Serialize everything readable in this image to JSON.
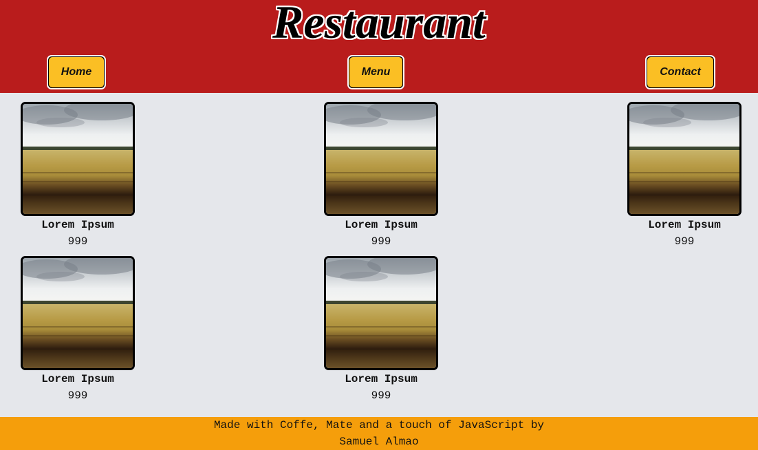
{
  "header": {
    "title": "Restaurant",
    "nav": [
      {
        "label": "Home"
      },
      {
        "label": "Menu"
      },
      {
        "label": "Contact"
      }
    ]
  },
  "items": [
    {
      "name": "Lorem Ipsum",
      "price": "999",
      "image": "wheat-field-photo"
    },
    {
      "name": "Lorem Ipsum",
      "price": "999",
      "image": "wheat-field-photo"
    },
    {
      "name": "Lorem Ipsum",
      "price": "999",
      "image": "wheat-field-photo"
    },
    {
      "name": "Lorem Ipsum",
      "price": "999",
      "image": "wheat-field-photo"
    },
    {
      "name": "Lorem Ipsum",
      "price": "999",
      "image": "wheat-field-photo"
    }
  ],
  "footer": {
    "line1": "Made with Coffe, Mate and a touch of JavaScript by",
    "line2": "Samuel Almao"
  },
  "colors": {
    "header_bg": "#b91c1c",
    "button_bg": "#fbbf24",
    "page_bg": "#e5e7eb",
    "footer_bg": "#f59e0b"
  }
}
